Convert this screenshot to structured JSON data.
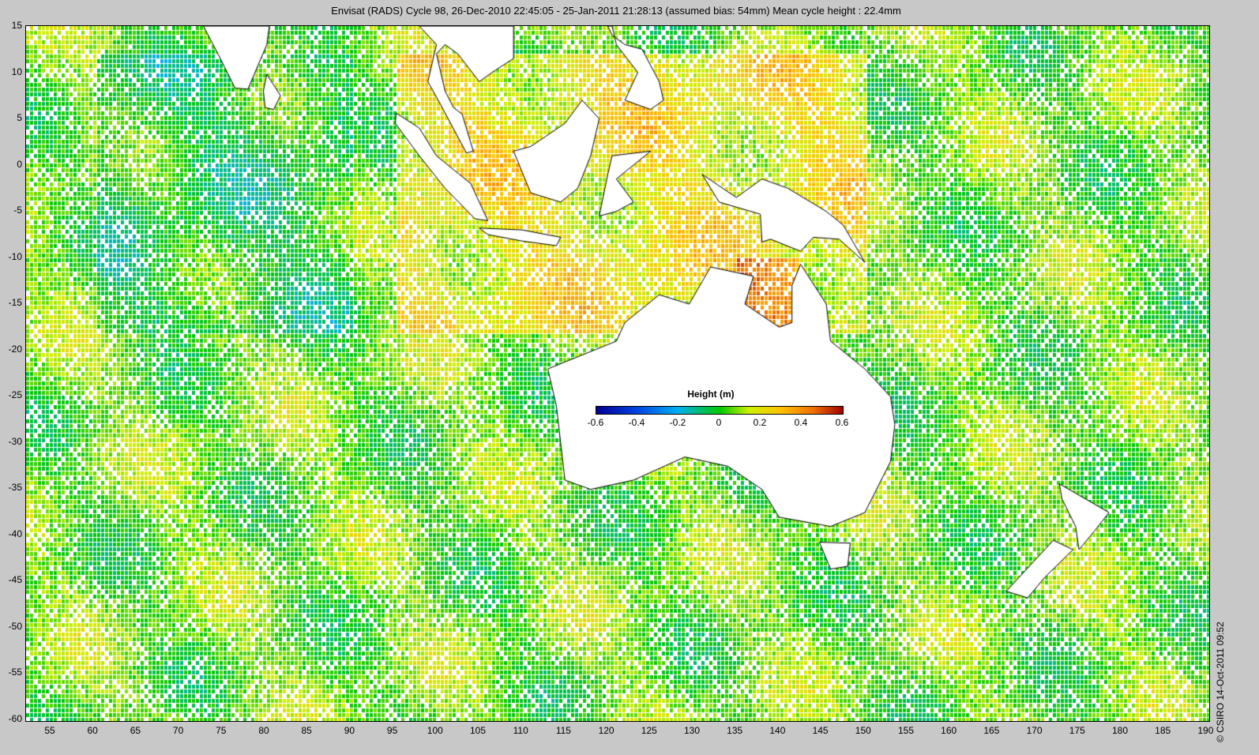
{
  "title": "Envisat (RADS) Cycle 98, 26-Dec-2010 22:45:05 - 25-Jan-2011 21:28:13 (assumed bias: 54mm)  Mean cycle height : 22.4mm",
  "colorbar": {
    "title": "Height (m)",
    "labels": [
      "-0.6",
      "-0.4",
      "-0.2",
      "0",
      "0.2",
      "0.4",
      "0.6"
    ],
    "min": -0.6,
    "max": 0.6
  },
  "axes": {
    "lat_labels": [
      "15",
      "10",
      "5",
      "0",
      "-5",
      "-10",
      "-15",
      "-20",
      "-25",
      "-30",
      "-35",
      "-40",
      "-45",
      "-50",
      "-55",
      "-60"
    ],
    "lon_labels": [
      "55",
      "60",
      "65",
      "70",
      "75",
      "80",
      "85",
      "90",
      "95",
      "100",
      "105",
      "110",
      "115",
      "120",
      "125",
      "130",
      "135",
      "140",
      "145",
      "150",
      "155",
      "160",
      "165",
      "170",
      "175",
      "180",
      "185",
      "190"
    ],
    "lat_range": [
      -60,
      15
    ],
    "lon_range": [
      52.1,
      190.2
    ]
  },
  "copyright": "© CSIRO 14-Oct-2011 09:52"
}
